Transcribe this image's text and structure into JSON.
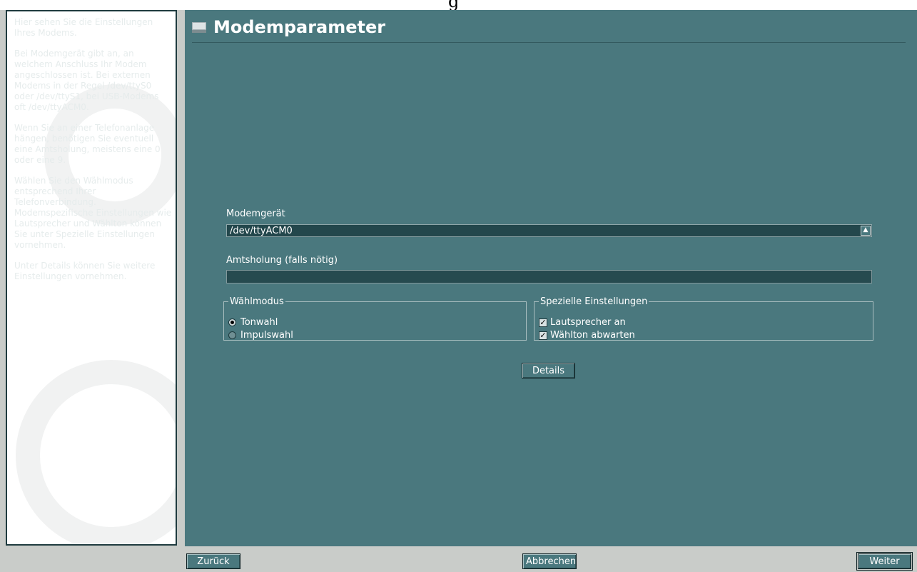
{
  "top_glyph": "g",
  "help": {
    "paragraphs": [
      "Hier sehen Sie die Einstellungen Ihres Modems.",
      "Bei Modemgerät gibt an, an welchem Anschluss Ihr Modem angeschlossen ist. Bei externen Modems in der Regel /dev/ttyS0 oder /dev/ttyS1, bei USB-Modems oft /dev/ttyACM0.",
      "Wenn Sie an einer Telefonanlage hängen, benötigen Sie eventuell eine Amtsholung, meistens eine 0 oder eine 9.",
      "Wählen Sie den Wählmodus entsprechend Ihrer Telefonverbindung. Modemspezifische Einstellungen wie Lautsprecher und Wählton können Sie unter Spezielle Einstellungen vornehmen.",
      "Unter Details können Sie weitere Einstellungen vornehmen."
    ]
  },
  "title": "Modemparameter",
  "modem_device": {
    "label": "Modemgerät",
    "value": "/dev/ttyACM0"
  },
  "dial_prefix": {
    "label": "Amtsholung (falls nötig)",
    "value": ""
  },
  "dial_mode": {
    "legend": "Wählmodus",
    "options": [
      {
        "label": "Tonwahl",
        "selected": true
      },
      {
        "label": "Impulswahl",
        "selected": false
      }
    ]
  },
  "special": {
    "legend": "Spezielle Einstellungen",
    "options": [
      {
        "label": "Lautsprecher an",
        "checked": true,
        "mark": "✓"
      },
      {
        "label": "Wählton abwarten",
        "checked": true,
        "mark": "✓"
      }
    ]
  },
  "buttons": {
    "details": "Details",
    "back": "Zurück",
    "cancel": "Abbrechen",
    "next": "Weiter"
  },
  "colors": {
    "pane": "#4a787e",
    "field": "#23474c",
    "help_bg": "#ffffff"
  }
}
